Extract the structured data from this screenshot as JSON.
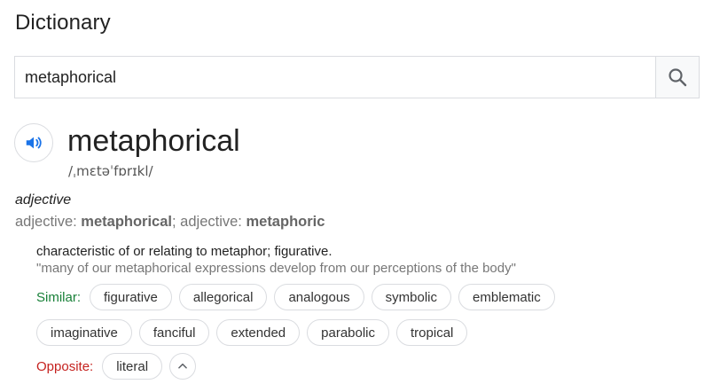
{
  "header": {
    "title": "Dictionary"
  },
  "search": {
    "value": "metaphorical",
    "button_icon": "search-icon"
  },
  "entry": {
    "speaker_icon": "speaker-icon",
    "word": "metaphorical",
    "phonetic": "/ˌmɛtəˈfɒrɪkl/",
    "part_of_speech": "adjective",
    "forms": [
      {
        "label": "adjective: ",
        "value": "metaphorical"
      },
      {
        "label": "adjective: ",
        "value": "metaphoric"
      }
    ],
    "forms_separator": "; ",
    "definition": "characteristic of or relating to metaphor; figurative.",
    "example": "\"many of our metaphorical expressions develop from our perceptions of the body\"",
    "similar_label": "Similar:",
    "similar": [
      "figurative",
      "allegorical",
      "analogous",
      "symbolic",
      "emblematic",
      "imaginative",
      "fanciful",
      "extended",
      "parabolic",
      "tropical"
    ],
    "opposite_label": "Opposite:",
    "opposite": [
      "literal"
    ],
    "expand_icon": "chevron-up-icon"
  },
  "colors": {
    "similar_label": "#188038",
    "opposite_label": "#c5221f",
    "speaker": "#1a73e8"
  }
}
